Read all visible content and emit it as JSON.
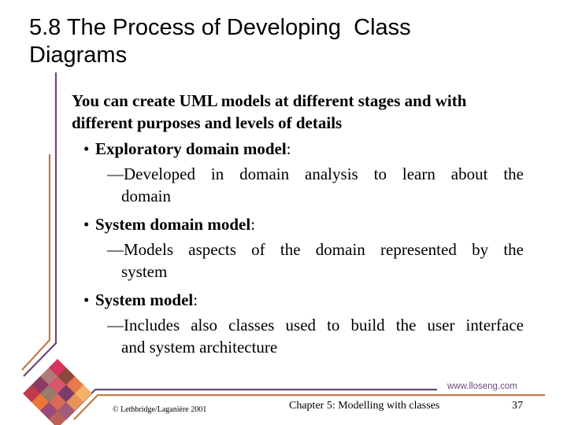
{
  "slide": {
    "title": "5.8 The Process of Developing  Class\nDiagrams",
    "intro": "You can create UML models at different stages and with different purposes and levels of details",
    "bullets": [
      {
        "term": "Exploratory domain model",
        "suffix": ":",
        "sub_first": "—Developed in domain analysis to learn about the",
        "sub_cont": "domain"
      },
      {
        "term": "System domain model",
        "suffix": ":",
        "sub_first": "—Models aspects of the domain represented by the",
        "sub_cont": "system"
      },
      {
        "term": "System model",
        "suffix": ":",
        "sub_first": "—Includes also classes used to build the user interface",
        "sub_cont": "and system architecture"
      }
    ],
    "bullet_glyph": "•"
  },
  "footer": {
    "copyright": "© Lethbridge/Laganière 2001",
    "chapter": "Chapter 5: Modelling with classes",
    "page_number": "37",
    "url": "www.lloseng.com"
  },
  "colors": {
    "purple_line": "#6b4a78",
    "orange_line": "#c07a45",
    "url_text": "#6b4a78"
  },
  "logo": {
    "icon": "woven-diamond-logo"
  }
}
